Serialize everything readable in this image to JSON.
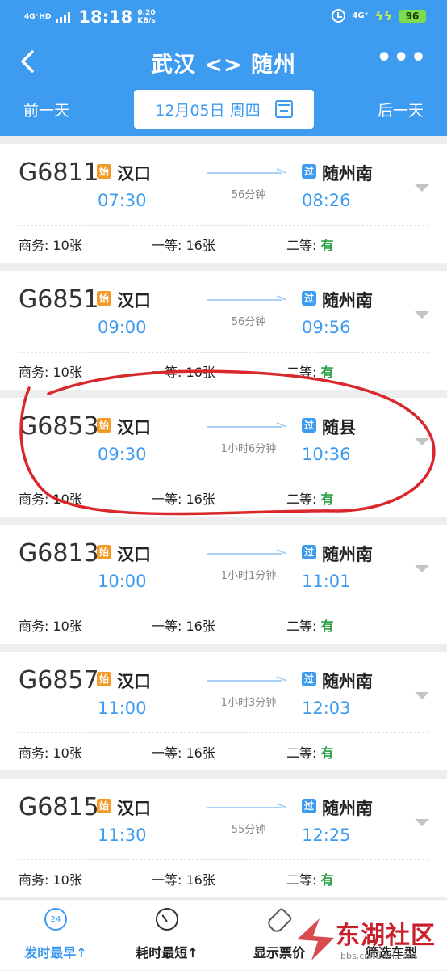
{
  "status_bar": {
    "network": "4G⁺HD",
    "time": "18:18",
    "speed_value": "0.20",
    "speed_unit": "KB/s",
    "mobile": "4G⁺",
    "battery": "96"
  },
  "header": {
    "title": "武汉 <> 随州",
    "prev_day": "前一天",
    "date": "12月05日 周四",
    "next_day": "后一天",
    "more": "•••"
  },
  "tags": {
    "start": "始",
    "pass": "过"
  },
  "trains": [
    {
      "no": "G6811",
      "from": "汉口",
      "dep": "07:30",
      "duration": "56分钟",
      "to": "随州南",
      "arr": "08:26",
      "business": "商务: 10张",
      "first": "一等: 16张",
      "second_label": "二等: ",
      "second_value": "有"
    },
    {
      "no": "G6851",
      "from": "汉口",
      "dep": "09:00",
      "duration": "56分钟",
      "to": "随州南",
      "arr": "09:56",
      "business": "商务: 10张",
      "first": "一等: 16张",
      "second_label": "二等: ",
      "second_value": "有"
    },
    {
      "no": "G6853",
      "from": "汉口",
      "dep": "09:30",
      "duration": "1小时6分钟",
      "to": "随县",
      "arr": "10:36",
      "business": "商务: 10张",
      "first": "一等: 16张",
      "second_label": "二等: ",
      "second_value": "有"
    },
    {
      "no": "G6813",
      "from": "汉口",
      "dep": "10:00",
      "duration": "1小时1分钟",
      "to": "随州南",
      "arr": "11:01",
      "business": "商务: 10张",
      "first": "一等: 16张",
      "second_label": "二等: ",
      "second_value": "有"
    },
    {
      "no": "G6857",
      "from": "汉口",
      "dep": "11:00",
      "duration": "1小时3分钟",
      "to": "随州南",
      "arr": "12:03",
      "business": "商务: 10张",
      "first": "一等: 16张",
      "second_label": "二等: ",
      "second_value": "有"
    },
    {
      "no": "G6815",
      "from": "汉口",
      "dep": "11:30",
      "duration": "55分钟",
      "to": "随州南",
      "arr": "12:25",
      "business": "商务: 10张",
      "first": "一等: 16张",
      "second_label": "二等: ",
      "second_value": "有"
    }
  ],
  "tabbar": {
    "clock_badge": "24",
    "earliest": "发时最早↑",
    "shortest": "耗时最短↑",
    "show_price": "显示票价",
    "filter": "筛选车型"
  },
  "watermark": {
    "text": "东湖社区",
    "url": "bbs.cnhubei.com"
  },
  "colors": {
    "primary": "#3d9bf0",
    "start_tag": "#f29a25",
    "available": "#2ba245",
    "annotation": "#d9272b"
  }
}
